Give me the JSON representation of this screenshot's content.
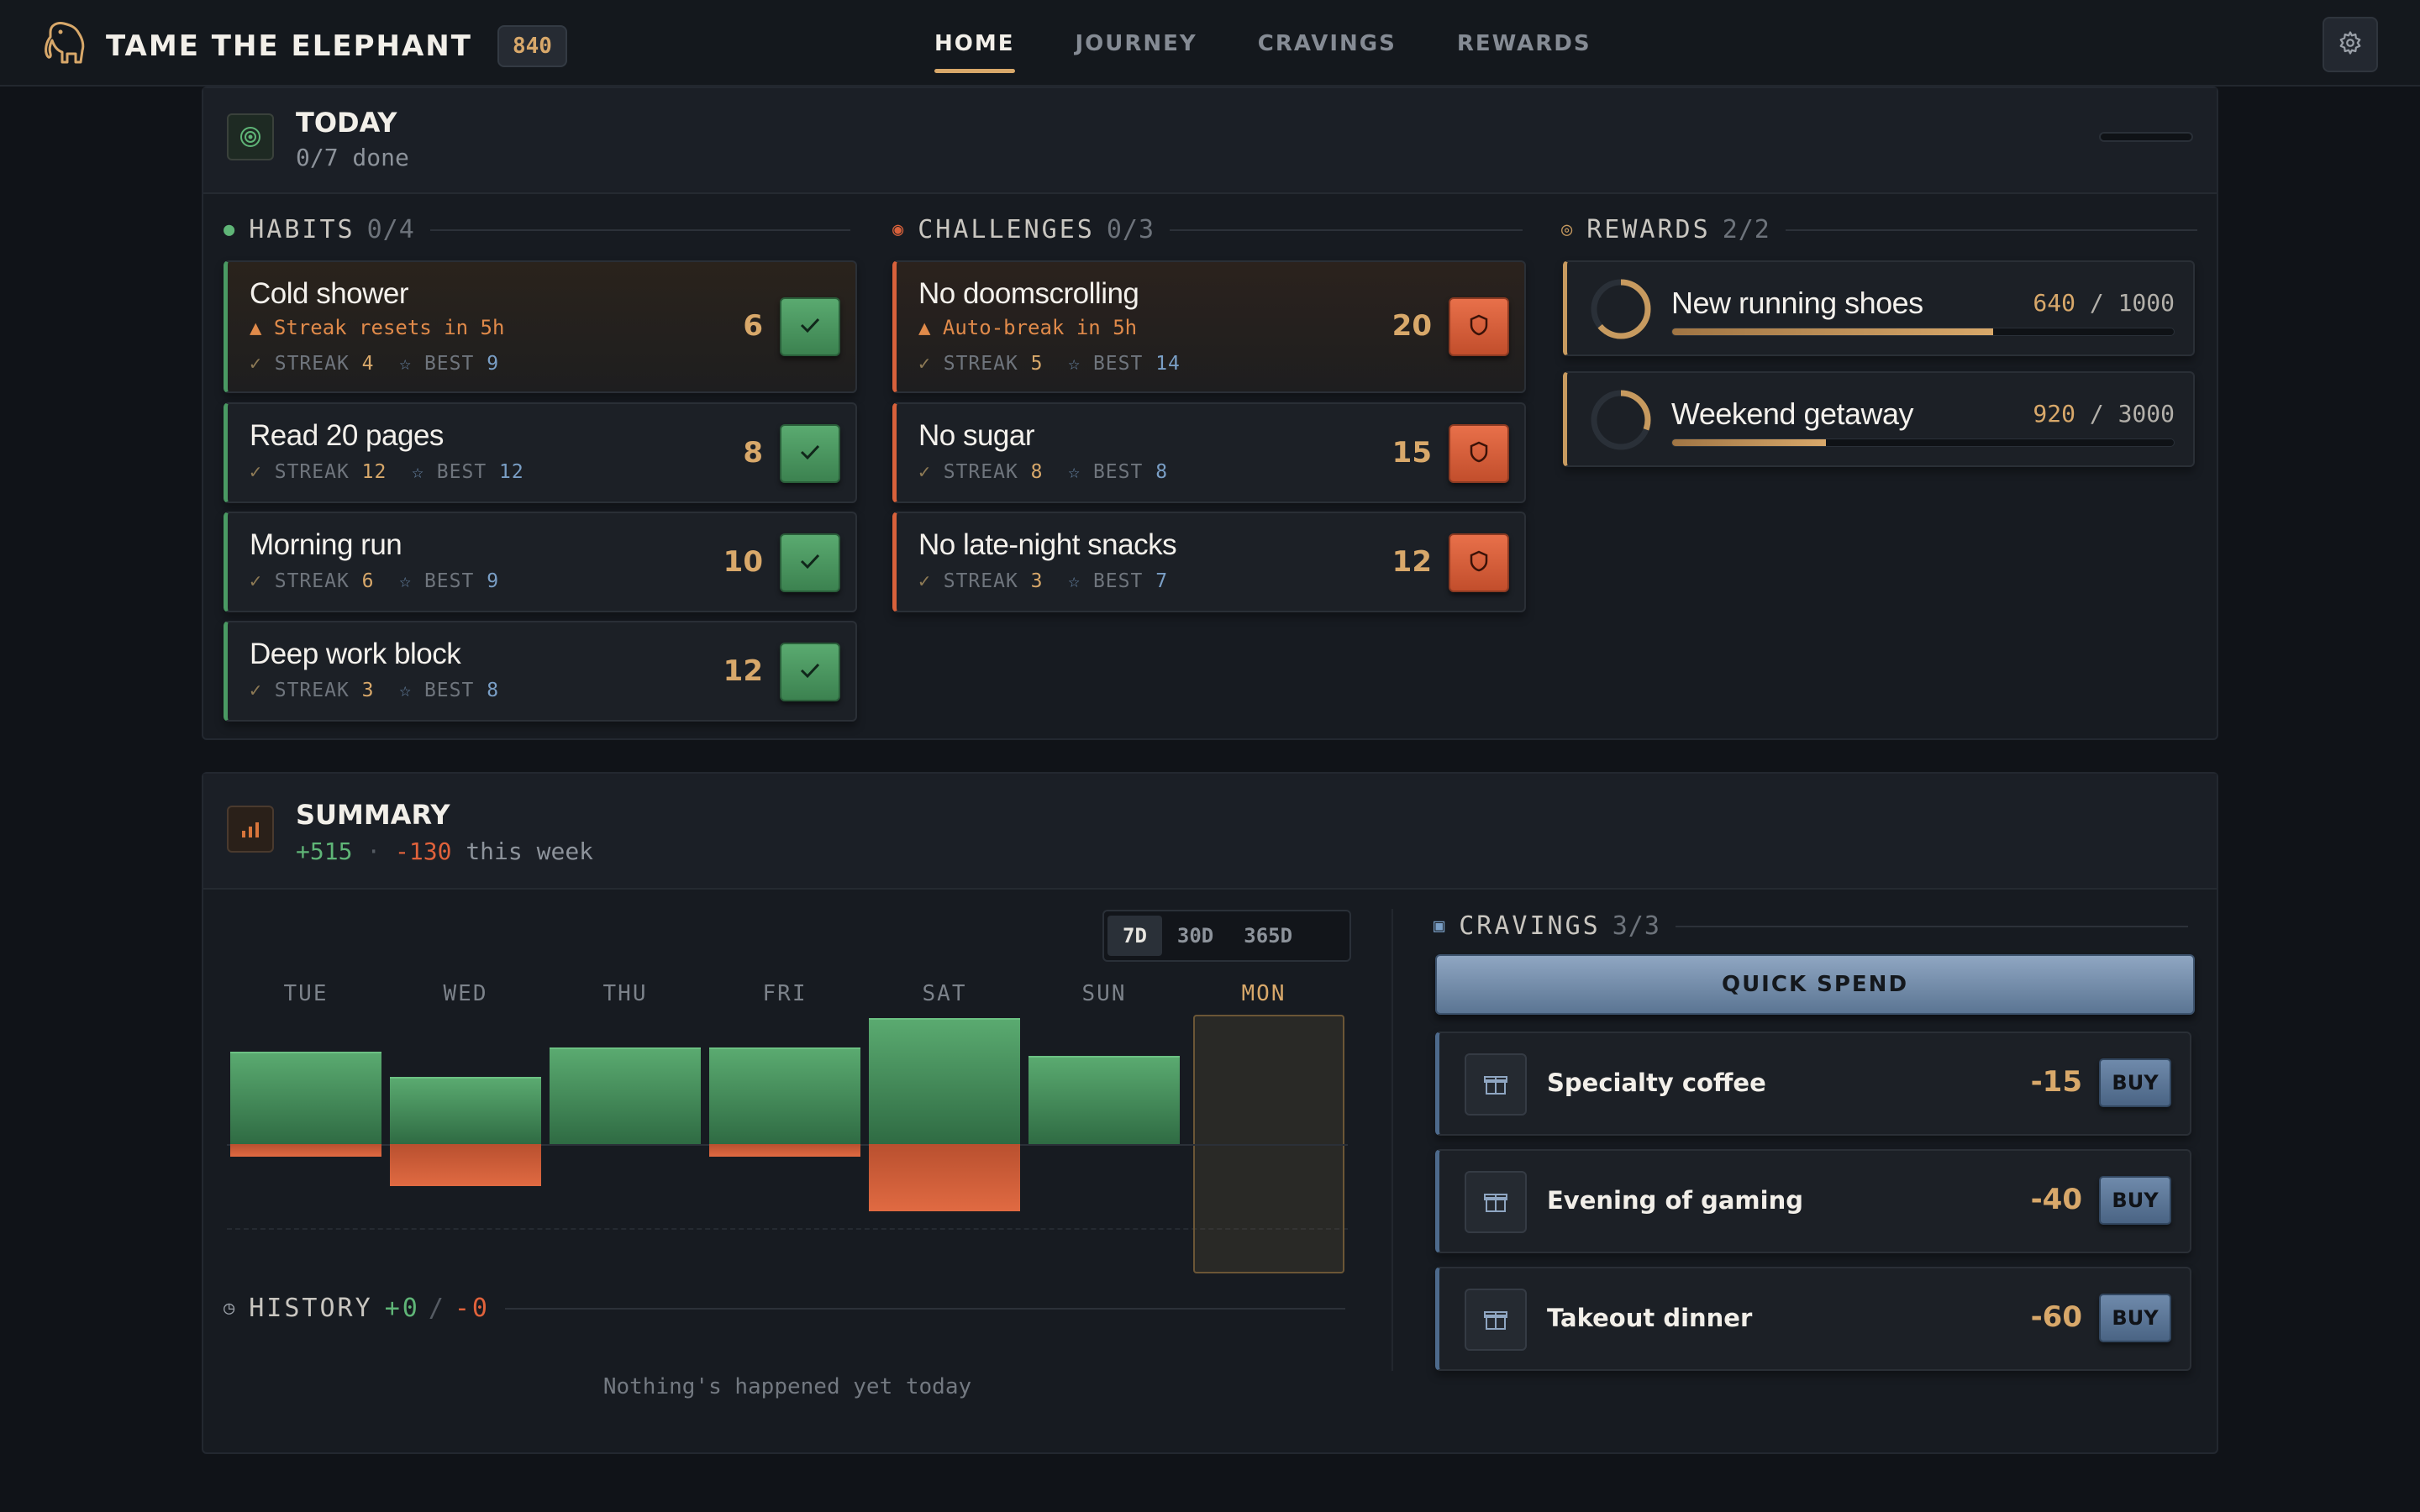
{
  "app": {
    "name": "TAME THE ELEPHANT",
    "points": "840"
  },
  "nav": {
    "home": "HOME",
    "journey": "JOURNEY",
    "cravings": "CRAVINGS",
    "rewards": "REWARDS"
  },
  "icons": {
    "logo": "elephant-icon",
    "settings": "gear-icon"
  },
  "colors": {
    "accent": "#d8a86a",
    "habit": "#4a9a63",
    "challenge": "#d8613b",
    "craving": "#4d6a8c",
    "background": "#101318"
  },
  "today": {
    "title": "TODAY",
    "subtitle": "0/7 done",
    "habits_label": "HABITS",
    "habits_count": "0/4",
    "challenges_label": "CHALLENGES",
    "challenges_count": "0/3",
    "rewards_label": "REWARDS",
    "rewards_count": "2/2",
    "streak_label": "STREAK",
    "best_label": "BEST",
    "habits": [
      {
        "name": "Cold shower",
        "warning": "Streak resets in 5h",
        "streak": "4",
        "best": "9",
        "points": "6"
      },
      {
        "name": "Read 20 pages",
        "streak": "12",
        "best": "12",
        "points": "8"
      },
      {
        "name": "Morning run",
        "streak": "6",
        "best": "9",
        "points": "10"
      },
      {
        "name": "Deep work block",
        "streak": "3",
        "best": "8",
        "points": "12"
      }
    ],
    "challenges": [
      {
        "name": "No doomscrolling",
        "warning": "Auto-break in 5h",
        "streak": "5",
        "best": "14",
        "points": "20"
      },
      {
        "name": "No sugar",
        "streak": "8",
        "best": "8",
        "points": "15"
      },
      {
        "name": "No late-night snacks",
        "streak": "3",
        "best": "7",
        "points": "12"
      }
    ],
    "rewards": [
      {
        "name": "New running shoes",
        "current": "640",
        "target": "1000",
        "progress": 0.64
      },
      {
        "name": "Weekend getaway",
        "current": "920",
        "target": "3000",
        "progress": 0.307
      }
    ]
  },
  "summary": {
    "title": "SUMMARY",
    "gain": "+515",
    "separator": "·",
    "loss": "-130",
    "period": "this week",
    "ranges": [
      "7D",
      "30D",
      "365D"
    ],
    "active_range": "7D",
    "history_label": "HISTORY",
    "history_gain": "+0",
    "history_sep": "/",
    "history_loss": "-0",
    "empty_message": "Nothing's happened yet today",
    "cravings_label": "CRAVINGS",
    "cravings_count": "3/3",
    "quick_spend": "QUICK SPEND",
    "buy_label": "BUY",
    "cravings": [
      {
        "name": "Specialty coffee",
        "cost": "-15"
      },
      {
        "name": "Evening of gaming",
        "cost": "-40"
      },
      {
        "name": "Takeout dinner",
        "cost": "-60"
      }
    ]
  },
  "chart_data": {
    "type": "bar",
    "categories": [
      "TUE",
      "WED",
      "THU",
      "FRI",
      "SAT",
      "SUN",
      "MON"
    ],
    "series": [
      {
        "values": [
          110,
          80,
          115,
          115,
          150,
          105,
          0
        ]
      },
      {
        "values": [
          -15,
          -50,
          0,
          -15,
          -80,
          0,
          0
        ]
      }
    ],
    "highlight": "MON"
  }
}
